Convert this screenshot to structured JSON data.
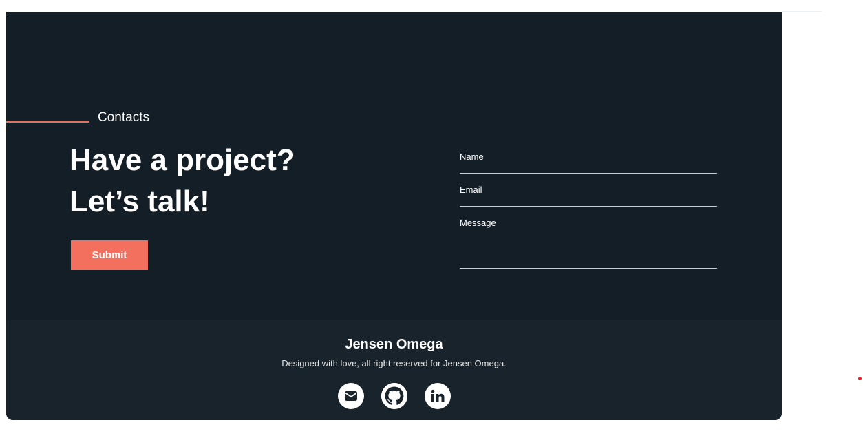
{
  "contact": {
    "section_label": "Contacts",
    "headline_line1": "Have a project?",
    "headline_line2": "Let’s talk!",
    "submit_label": "Submit"
  },
  "form": {
    "name_label": "Name",
    "email_label": "Email",
    "message_label": "Message"
  },
  "footer": {
    "name": "Jensen Omega",
    "tagline": "Designed with love, all right reserved for Jensen Omega.",
    "socials": [
      {
        "icon": "mail-icon"
      },
      {
        "icon": "github-icon"
      },
      {
        "icon": "linkedin-icon"
      }
    ]
  },
  "colors": {
    "background": "#131e26",
    "footer_background": "#19232b",
    "accent": "#f4705e"
  }
}
